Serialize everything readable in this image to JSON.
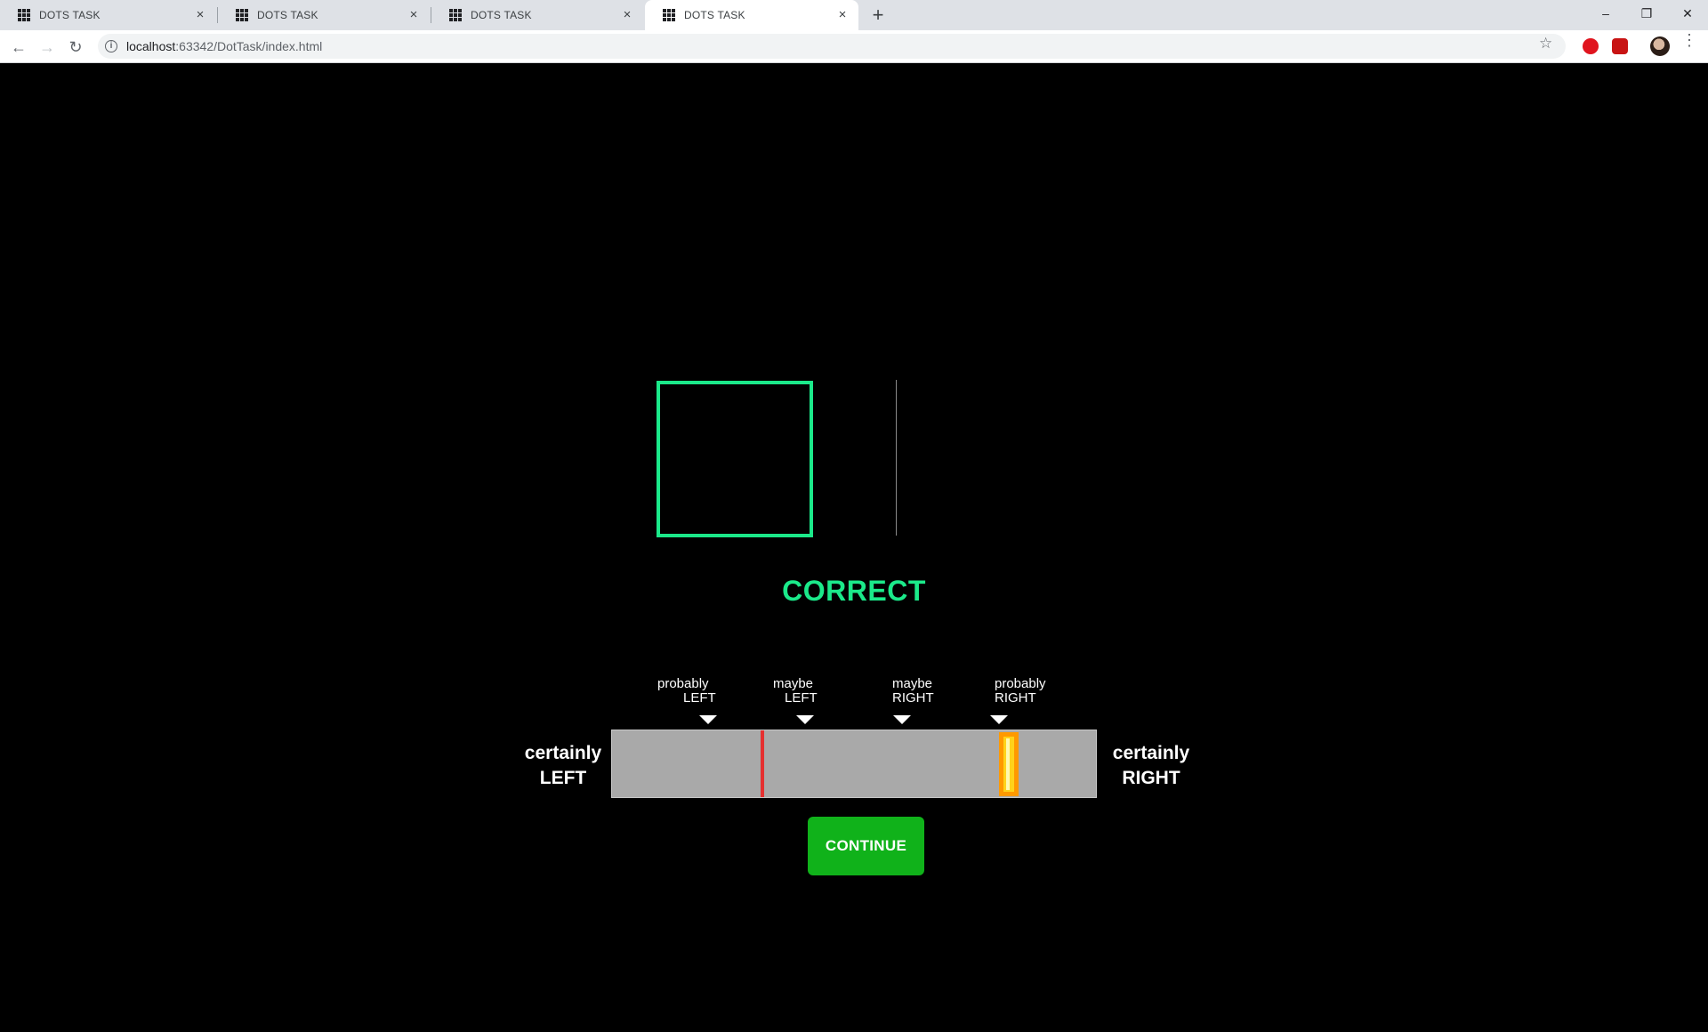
{
  "browser": {
    "tabs": [
      {
        "title": "DOTS TASK",
        "active": false
      },
      {
        "title": "DOTS TASK",
        "active": false
      },
      {
        "title": "DOTS TASK",
        "active": false
      },
      {
        "title": "DOTS TASK",
        "active": true
      }
    ],
    "tab_close_glyph": "×",
    "new_tab_glyph": "+",
    "window_controls": {
      "minimize": "–",
      "restore": "❐",
      "close": "✕"
    },
    "nav": {
      "back": "←",
      "forward": "→",
      "reload": "↻"
    },
    "url_host": "localhost",
    "url_rest": ":63342/DotTask/index.html",
    "info_glyph": "i",
    "star_glyph": "☆",
    "menu_glyph": "⋮",
    "colors": {
      "tabstrip": "#dee1e6",
      "omnibox": "#f1f3f4"
    }
  },
  "task": {
    "feedback": "CORRECT",
    "scale": {
      "left_end": {
        "line1": "certainly",
        "line2": "LEFT"
      },
      "right_end": {
        "line1": "certainly",
        "line2": "RIGHT"
      },
      "markers": [
        {
          "line1": "probably",
          "line2": "LEFT"
        },
        {
          "line1": "maybe",
          "line2": "LEFT"
        },
        {
          "line1": "maybe",
          "line2": "RIGHT"
        },
        {
          "line1": "probably",
          "line2": "RIGHT"
        }
      ],
      "correct_position": 0.31,
      "response_position": 0.82
    },
    "continue_label": "CONTINUE",
    "colors": {
      "stimulus_border": "#1be98a",
      "feedback": "#1be98a",
      "scale_bg": "#a9a9a9",
      "correct_marker": "#e53030",
      "handle_fill": "#ffd21a",
      "handle_border": "#ff9900",
      "continue_bg": "#10b21a"
    }
  }
}
